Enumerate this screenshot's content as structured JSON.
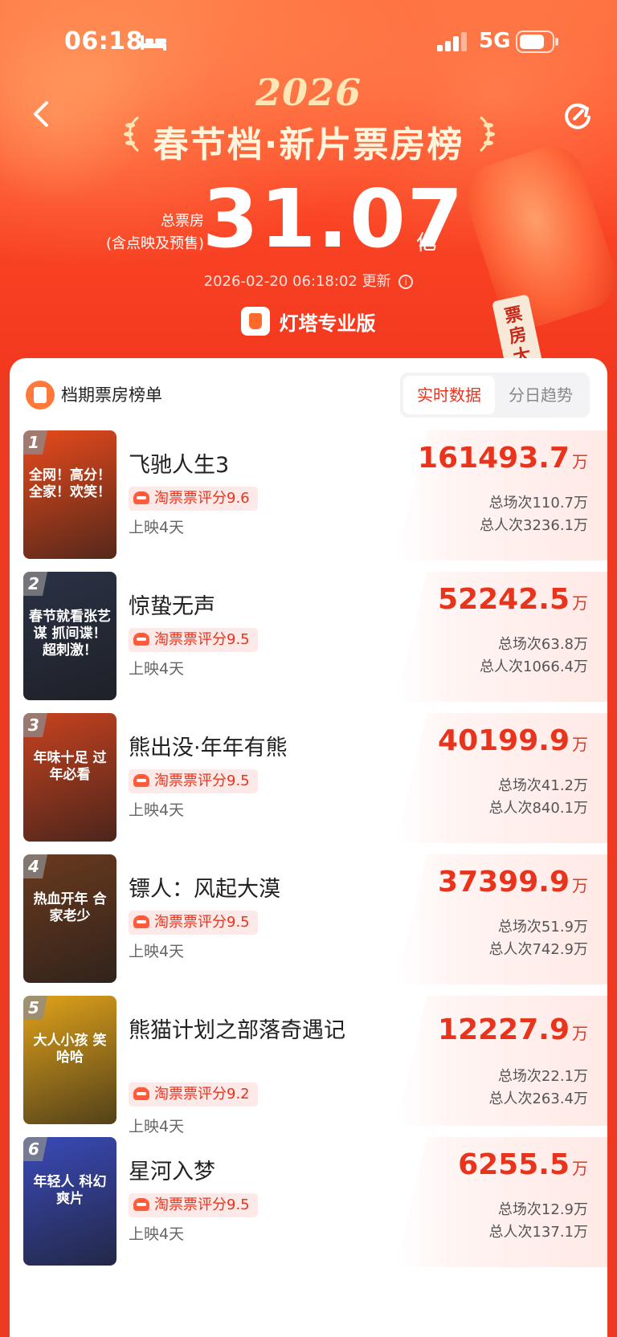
{
  "status": {
    "time": "06:18",
    "network": "5G"
  },
  "header": {
    "year": "2026",
    "title": "春节档·新片票房榜",
    "total_label_1": "总票房",
    "total_label_2": "(含点映及预售)",
    "total_value": "31.07",
    "total_unit": "亿",
    "update_time": "2026-02-20 06:18:02 更新",
    "brand": "灯塔专业版",
    "tag_text": "票房大"
  },
  "list": {
    "title": "档期票房榜单",
    "tabs": [
      "实时数据",
      "分日趋势"
    ],
    "rating_prefix": "淘票票评分",
    "box_unit": "万",
    "movies": [
      {
        "rank": "1",
        "title": "飞驰人生3",
        "rating": "9.6",
        "days": "上映4天",
        "box": "161493.7",
        "shows": "总场次110.7万",
        "viewers": "总人次3236.1万",
        "poster_text": "全网！高分！全家！欢笑！",
        "poster_color": "#e84a1c"
      },
      {
        "rank": "2",
        "title": "惊蛰无声",
        "rating": "9.5",
        "days": "上映4天",
        "box": "52242.5",
        "shows": "总场次63.8万",
        "viewers": "总人次1066.4万",
        "poster_text": "春节就看张艺谋 抓间谍！超刺激！",
        "poster_color": "#2a3246"
      },
      {
        "rank": "3",
        "title": "熊出没·年年有熊",
        "rating": "9.5",
        "days": "上映4天",
        "box": "40199.9",
        "shows": "总场次41.2万",
        "viewers": "总人次840.1万",
        "poster_text": "年味十足 过年必看",
        "poster_color": "#c8421f"
      },
      {
        "rank": "4",
        "title": "镖人：风起大漠",
        "rating": "9.5",
        "days": "上映4天",
        "box": "37399.9",
        "shows": "总场次51.9万",
        "viewers": "总人次742.9万",
        "poster_text": "热血开年 合家老少",
        "poster_color": "#6a3a1e"
      },
      {
        "rank": "5",
        "title": "熊猫计划之部落奇遇记",
        "rating": "9.2",
        "days": "上映4天",
        "box": "12227.9",
        "shows": "总场次22.1万",
        "viewers": "总人次263.4万",
        "poster_text": "大人小孩 笑哈哈",
        "poster_color": "#e0a21a"
      },
      {
        "rank": "6",
        "title": "星河入梦",
        "rating": "9.5",
        "days": "上映4天",
        "box": "6255.5",
        "shows": "总场次12.9万",
        "viewers": "总人次137.1万",
        "poster_text": "年轻人 科幻爽片",
        "poster_color": "#3a4ab8"
      }
    ]
  }
}
